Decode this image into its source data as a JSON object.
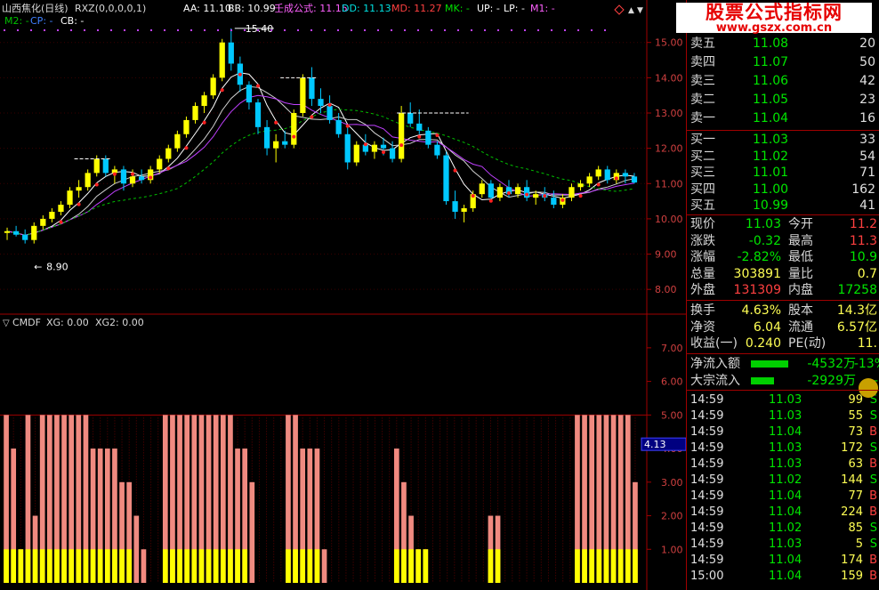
{
  "header": {
    "stock": "山西焦化(日线)",
    "indicator": "RXZ(0,0,0,0,1)",
    "aa": "AA: 11.10",
    "bb": "BB: 10.99",
    "formula": "壬成公式: 11.15",
    "dd": "DD: 11.13",
    "md": "MD: 11.27",
    "mk": "MK: -",
    "up": "UP: -",
    "lp": "LP: -",
    "m1": "M1: -",
    "m2": "M2: -",
    "cp": "CP: -",
    "cb": "CB: -"
  },
  "lower_header": {
    "name": "CMDF",
    "xg": "XG: 0.00",
    "xg2": "XG2: 0.00"
  },
  "colors": {
    "up_candle": "#ffff00",
    "down_candle": "#00c8ff",
    "pink_bar": "#f08a80",
    "yellow_bar": "#ffff00",
    "border": "#a00000",
    "price_green": "#00e600",
    "price_red": "#ff4040"
  },
  "watermark": {
    "title": "股票公式指标网",
    "url": "www.gszx.com.cn"
  },
  "chart_data": [
    {
      "type": "candlestick",
      "title": "山西焦化(日线)",
      "ylim": [
        7.5,
        15.8
      ],
      "y_ticks": [
        "15.00",
        "14.00",
        "13.00",
        "12.00",
        "11.00",
        "10.00",
        "9.00",
        "8.00"
      ],
      "annotations": [
        {
          "label": "15.40"
        },
        {
          "label": "8.90"
        }
      ],
      "candles": [
        [
          9.6,
          9.75,
          9.4,
          9.65
        ],
        [
          9.65,
          9.8,
          9.5,
          9.55
        ],
        [
          9.55,
          9.7,
          9.3,
          9.4
        ],
        [
          9.4,
          9.9,
          9.3,
          9.8
        ],
        [
          9.8,
          10.1,
          9.7,
          10.0
        ],
        [
          10.0,
          10.3,
          9.9,
          10.2
        ],
        [
          10.2,
          10.5,
          10.1,
          10.4
        ],
        [
          10.4,
          10.9,
          10.3,
          10.8
        ],
        [
          10.8,
          11.1,
          10.6,
          10.9
        ],
        [
          10.9,
          11.4,
          10.8,
          11.3
        ],
        [
          11.3,
          11.8,
          11.2,
          11.7
        ],
        [
          11.7,
          11.8,
          11.2,
          11.3
        ],
        [
          11.3,
          11.5,
          11.0,
          11.4
        ],
        [
          11.4,
          11.5,
          10.8,
          11.0
        ],
        [
          11.0,
          11.4,
          10.9,
          11.2
        ],
        [
          11.2,
          11.4,
          11.0,
          11.1
        ],
        [
          11.1,
          11.5,
          11.0,
          11.4
        ],
        [
          11.4,
          11.8,
          11.3,
          11.7
        ],
        [
          11.7,
          12.1,
          11.6,
          12.0
        ],
        [
          12.0,
          12.5,
          11.9,
          12.4
        ],
        [
          12.4,
          12.9,
          12.3,
          12.8
        ],
        [
          12.8,
          13.3,
          12.7,
          13.2
        ],
        [
          13.2,
          13.6,
          13.0,
          13.5
        ],
        [
          13.5,
          14.1,
          13.4,
          14.0
        ],
        [
          14.0,
          15.1,
          13.9,
          15.0
        ],
        [
          15.0,
          15.4,
          14.2,
          14.4
        ],
        [
          14.4,
          14.6,
          13.6,
          13.8
        ],
        [
          13.8,
          13.9,
          13.1,
          13.3
        ],
        [
          13.3,
          13.4,
          12.4,
          12.6
        ],
        [
          12.6,
          12.8,
          11.8,
          12.0
        ],
        [
          12.0,
          12.4,
          11.6,
          12.2
        ],
        [
          12.2,
          12.5,
          12.0,
          12.1
        ],
        [
          12.1,
          13.1,
          12.0,
          13.0
        ],
        [
          13.0,
          14.1,
          12.9,
          14.0
        ],
        [
          14.0,
          14.3,
          13.2,
          13.4
        ],
        [
          13.4,
          13.7,
          13.0,
          13.2
        ],
        [
          13.2,
          13.5,
          12.7,
          12.8
        ],
        [
          12.8,
          13.0,
          12.3,
          12.4
        ],
        [
          12.4,
          12.6,
          11.4,
          11.6
        ],
        [
          11.6,
          12.2,
          11.5,
          12.1
        ],
        [
          12.1,
          12.4,
          11.8,
          11.9
        ],
        [
          11.9,
          12.2,
          11.7,
          12.1
        ],
        [
          12.1,
          12.3,
          11.8,
          12.0
        ],
        [
          12.0,
          12.2,
          11.6,
          11.7
        ],
        [
          11.7,
          13.2,
          11.6,
          13.0
        ],
        [
          13.0,
          13.3,
          12.6,
          12.7
        ],
        [
          12.7,
          13.1,
          12.4,
          12.5
        ],
        [
          12.5,
          12.6,
          12.0,
          12.1
        ],
        [
          12.1,
          12.2,
          11.7,
          11.8
        ],
        [
          11.8,
          11.9,
          10.4,
          10.5
        ],
        [
          10.5,
          10.8,
          10.0,
          10.2
        ],
        [
          10.2,
          10.4,
          9.9,
          10.3
        ],
        [
          10.3,
          10.8,
          10.2,
          10.7
        ],
        [
          10.7,
          11.1,
          10.6,
          11.0
        ],
        [
          11.0,
          11.1,
          10.5,
          10.6
        ],
        [
          10.6,
          11.0,
          10.5,
          10.9
        ],
        [
          10.9,
          11.1,
          10.6,
          10.7
        ],
        [
          10.7,
          11.0,
          10.6,
          10.9
        ],
        [
          10.9,
          11.1,
          10.5,
          10.6
        ],
        [
          10.6,
          10.8,
          10.4,
          10.7
        ],
        [
          10.7,
          10.9,
          10.5,
          10.6
        ],
        [
          10.6,
          10.8,
          10.3,
          10.4
        ],
        [
          10.4,
          10.7,
          10.3,
          10.6
        ],
        [
          10.6,
          11.0,
          10.5,
          10.9
        ],
        [
          10.9,
          11.1,
          10.8,
          11.0
        ],
        [
          11.0,
          11.3,
          10.9,
          11.2
        ],
        [
          11.2,
          11.5,
          11.1,
          11.4
        ],
        [
          11.4,
          11.5,
          11.0,
          11.1
        ],
        [
          11.1,
          11.4,
          11.0,
          11.3
        ],
        [
          11.3,
          11.4,
          11.0,
          11.2
        ],
        [
          11.2,
          11.3,
          11.0,
          11.03
        ]
      ]
    },
    {
      "type": "bar",
      "title": "CMDF",
      "ylim": [
        0,
        7.5
      ],
      "y_ticks": [
        "7.00",
        "6.00",
        "5.00",
        "4.00",
        "3.00",
        "2.00",
        "1.00"
      ],
      "current_value_label": "4.13",
      "pink_values": [
        5,
        4,
        1,
        5,
        2,
        5,
        5,
        5,
        5,
        5,
        5,
        5,
        4,
        4,
        4,
        4,
        3,
        3,
        2,
        1,
        0,
        0,
        5,
        5,
        5,
        5,
        5,
        5,
        5,
        5,
        5,
        5,
        4,
        4,
        3,
        0,
        0,
        0,
        0,
        5,
        5,
        4,
        4,
        4,
        1,
        0,
        0,
        0,
        0,
        0,
        0,
        0,
        0,
        0,
        4,
        3,
        2,
        1,
        1,
        0,
        0,
        0,
        0,
        0,
        0,
        0,
        0,
        2,
        2,
        0,
        0,
        0,
        0,
        0,
        0,
        0,
        0,
        0,
        0,
        5,
        5,
        5,
        5,
        5,
        5,
        5,
        5,
        3
      ],
      "yellow_values": [
        1,
        1,
        1,
        1,
        1,
        1,
        1,
        1,
        1,
        1,
        1,
        1,
        1,
        1,
        1,
        1,
        1,
        1,
        0,
        0,
        0,
        0,
        1,
        1,
        1,
        1,
        1,
        1,
        1,
        1,
        1,
        1,
        1,
        1,
        0,
        0,
        0,
        0,
        0,
        1,
        1,
        1,
        1,
        1,
        0,
        0,
        0,
        0,
        0,
        0,
        0,
        0,
        0,
        0,
        1,
        1,
        1,
        1,
        1,
        0,
        0,
        0,
        0,
        0,
        0,
        0,
        0,
        1,
        1,
        0,
        0,
        0,
        0,
        0,
        0,
        0,
        0,
        0,
        0,
        1,
        1,
        1,
        1,
        1,
        1,
        1,
        1,
        1
      ]
    }
  ],
  "orderbook": {
    "asks": [
      {
        "label": "卖五",
        "price": "11.08",
        "vol": "20"
      },
      {
        "label": "卖四",
        "price": "11.07",
        "vol": "50"
      },
      {
        "label": "卖三",
        "price": "11.06",
        "vol": "42"
      },
      {
        "label": "卖二",
        "price": "11.05",
        "vol": "23"
      },
      {
        "label": "卖一",
        "price": "11.04",
        "vol": "16"
      }
    ],
    "bids": [
      {
        "label": "买一",
        "price": "11.03",
        "vol": "33"
      },
      {
        "label": "买二",
        "price": "11.02",
        "vol": "54"
      },
      {
        "label": "买三",
        "price": "11.01",
        "vol": "71"
      },
      {
        "label": "买四",
        "price": "11.00",
        "vol": "162"
      },
      {
        "label": "买五",
        "price": "10.99",
        "vol": "41"
      }
    ]
  },
  "quote": [
    {
      "l1": "现价",
      "v1": "11.03",
      "c1": "g",
      "l2": "今开",
      "v2": "11.2",
      "c2": "r"
    },
    {
      "l1": "涨跌",
      "v1": "-0.32",
      "c1": "g",
      "l2": "最高",
      "v2": "11.3",
      "c2": "r"
    },
    {
      "l1": "涨幅",
      "v1": "-2.82%",
      "c1": "g",
      "l2": "最低",
      "v2": "10.9",
      "c2": "g"
    },
    {
      "l1": "总量",
      "v1": "303891",
      "c1": "y",
      "l2": "量比",
      "v2": "0.7",
      "c2": "y"
    },
    {
      "l1": "外盘",
      "v1": "131309",
      "c1": "r",
      "l2": "内盘",
      "v2": "17258",
      "c2": "g"
    }
  ],
  "fundamentals": [
    {
      "l1": "换手",
      "v1": "4.63%",
      "l2": "股本",
      "v2": "14.3亿"
    },
    {
      "l1": "净资",
      "v1": "6.04",
      "l2": "流通",
      "v2": "6.57亿"
    },
    {
      "l1": "收益(一)",
      "v1": "0.240",
      "l2": "PE(动)",
      "v2": "11."
    }
  ],
  "flows": [
    {
      "label": "净流入额",
      "value": "-4532万",
      "pct": "-13%"
    },
    {
      "label": "大宗流入",
      "value": "-2929万",
      "pct": "-9"
    }
  ],
  "trades": [
    {
      "time": "14:59",
      "price": "11.03",
      "vol": "99",
      "side": "S",
      "sc": "g"
    },
    {
      "time": "14:59",
      "price": "11.03",
      "vol": "55",
      "side": "S",
      "sc": "g"
    },
    {
      "time": "14:59",
      "price": "11.04",
      "vol": "73",
      "side": "B",
      "sc": "r"
    },
    {
      "time": "14:59",
      "price": "11.03",
      "vol": "172",
      "side": "S",
      "sc": "g"
    },
    {
      "time": "14:59",
      "price": "11.03",
      "vol": "63",
      "side": "B",
      "sc": "r"
    },
    {
      "time": "14:59",
      "price": "11.02",
      "vol": "144",
      "side": "S",
      "sc": "g"
    },
    {
      "time": "14:59",
      "price": "11.04",
      "vol": "77",
      "side": "B",
      "sc": "r"
    },
    {
      "time": "14:59",
      "price": "11.04",
      "vol": "224",
      "side": "B",
      "sc": "r"
    },
    {
      "time": "14:59",
      "price": "11.02",
      "vol": "85",
      "side": "S",
      "sc": "g"
    },
    {
      "time": "14:59",
      "price": "11.03",
      "vol": "5",
      "side": "S",
      "sc": "g"
    },
    {
      "time": "14:59",
      "price": "11.04",
      "vol": "174",
      "side": "B",
      "sc": "r"
    },
    {
      "time": "15:00",
      "price": "11.04",
      "vol": "159",
      "side": "B",
      "sc": "r"
    }
  ]
}
